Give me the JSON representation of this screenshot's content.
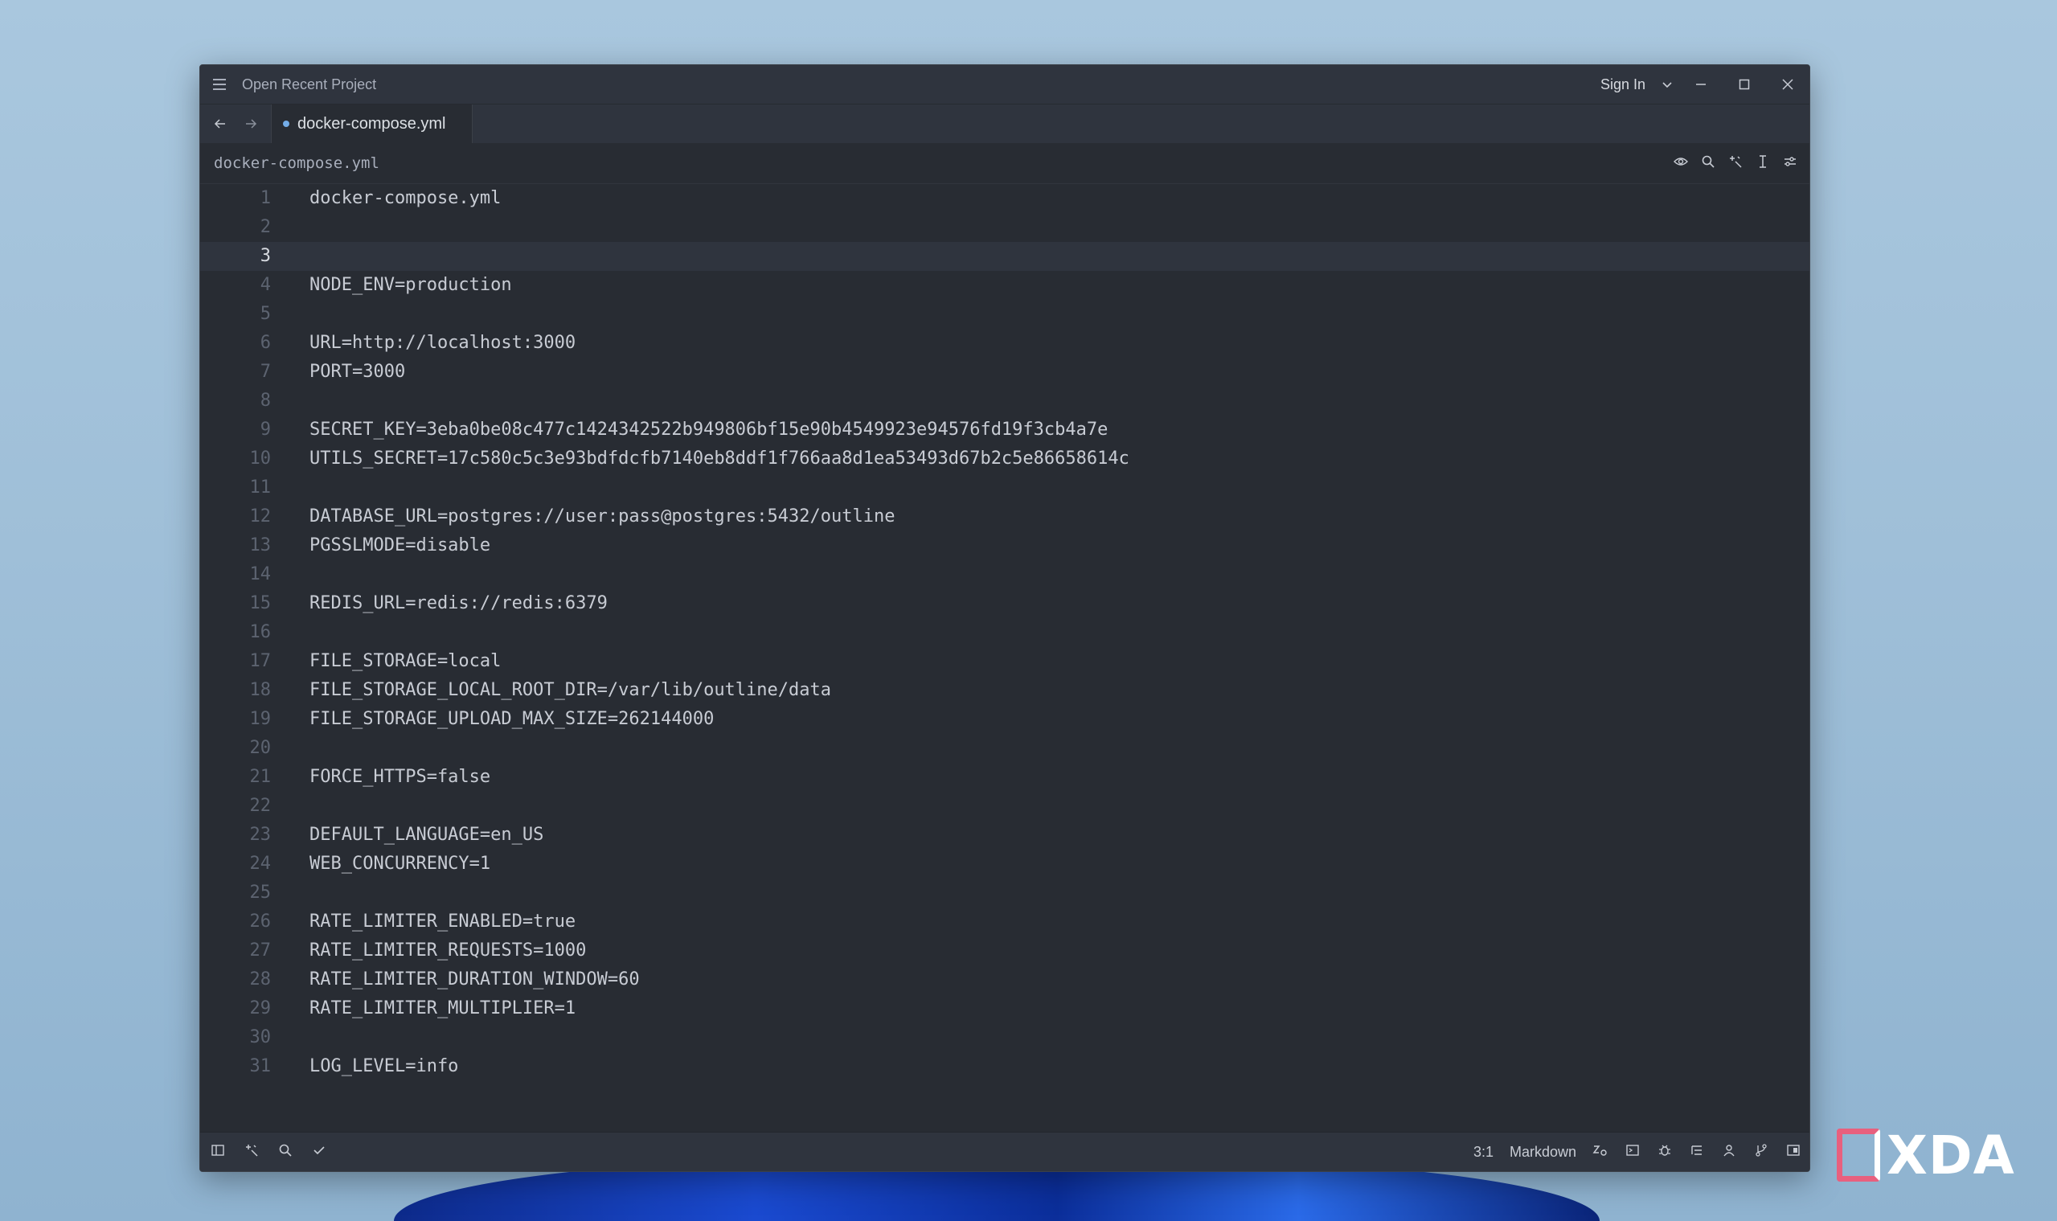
{
  "window": {
    "title": "Open Recent Project",
    "sign_in": "Sign In",
    "icons": {
      "menu": "hamburger-menu-icon",
      "dropdown": "chevron-down-icon",
      "minimize": "minimize-icon",
      "maximize": "maximize-icon",
      "close": "close-icon"
    }
  },
  "tabs": [
    {
      "label": "docker-compose.yml",
      "active": true,
      "modified_dot_color": "#74ade8"
    }
  ],
  "breadcrumb": "docker-compose.yml",
  "toolbar_icons": [
    "eye-icon",
    "search-icon",
    "sparkle-icon",
    "text-cursor-icon",
    "sliders-icon"
  ],
  "editor": {
    "current_line": 3,
    "lines": [
      "docker-compose.yml",
      "",
      "",
      "NODE_ENV=production",
      "",
      "URL=http://localhost:3000",
      "PORT=3000",
      "",
      "SECRET_KEY=3eba0be08c477c1424342522b949806bf15e90b4549923e94576fd19f3cb4a7e",
      "UTILS_SECRET=17c580c5c3e93bdfdcfb7140eb8ddf1f766aa8d1ea53493d67b2c5e86658614c",
      "",
      "DATABASE_URL=postgres://user:pass@postgres:5432/outline",
      "PGSSLMODE=disable",
      "",
      "REDIS_URL=redis://redis:6379",
      "",
      "FILE_STORAGE=local",
      "FILE_STORAGE_LOCAL_ROOT_DIR=/var/lib/outline/data",
      "FILE_STORAGE_UPLOAD_MAX_SIZE=262144000",
      "",
      "FORCE_HTTPS=false",
      "",
      "DEFAULT_LANGUAGE=en_US",
      "WEB_CONCURRENCY=1",
      "",
      "RATE_LIMITER_ENABLED=true",
      "RATE_LIMITER_REQUESTS=1000",
      "RATE_LIMITER_DURATION_WINDOW=60",
      "RATE_LIMITER_MULTIPLIER=1",
      "",
      "LOG_LEVEL=info"
    ]
  },
  "statusbar": {
    "cursor_position": "3:1",
    "language": "Markdown"
  },
  "watermark": "XDA",
  "colors": {
    "editor_bg": "#282c33",
    "chrome_bg": "#2f343e",
    "text": "#c8ccd4",
    "line_number": "#5c6370",
    "accent": "#74ade8"
  }
}
